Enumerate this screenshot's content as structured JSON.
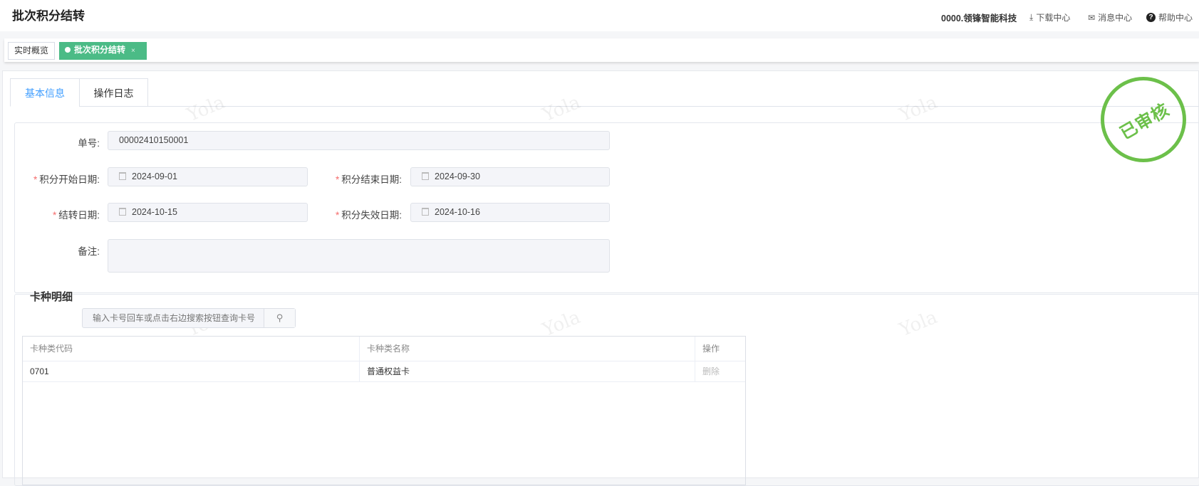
{
  "header": {
    "title": "批次积分结转",
    "company": "0000.领锋智能科技",
    "download": "下载中心",
    "messages": "消息中心",
    "help": "帮助中心"
  },
  "page_tabs": [
    {
      "label": "实时概览"
    },
    {
      "label": "批次积分结转",
      "close": "×"
    }
  ],
  "sub_tabs": [
    {
      "label": "基本信息"
    },
    {
      "label": "操作日志"
    }
  ],
  "form": {
    "order_no": {
      "label": "单号:",
      "value": "00002410150001"
    },
    "start_date": {
      "label": "积分开始日期:",
      "value": "2024-09-01"
    },
    "end_date": {
      "label": "积分结束日期:",
      "value": "2024-09-30"
    },
    "transfer_date": {
      "label": "结转日期:",
      "value": "2024-10-15"
    },
    "expire_date": {
      "label": "积分失效日期:",
      "value": "2024-10-16"
    },
    "remark": {
      "label": "备注:",
      "value": ""
    },
    "required_mark": "*"
  },
  "stamp": "已审核",
  "watermark": "Yola",
  "card_section": {
    "title": "卡种明细",
    "search_placeholder": "输入卡号回车或点击右边搜索按钮查询卡号",
    "columns": [
      "卡种类代码",
      "卡种类名称",
      "操作"
    ],
    "rows": [
      {
        "code": "0701",
        "name": "普通权益卡",
        "action": "删除"
      }
    ]
  }
}
